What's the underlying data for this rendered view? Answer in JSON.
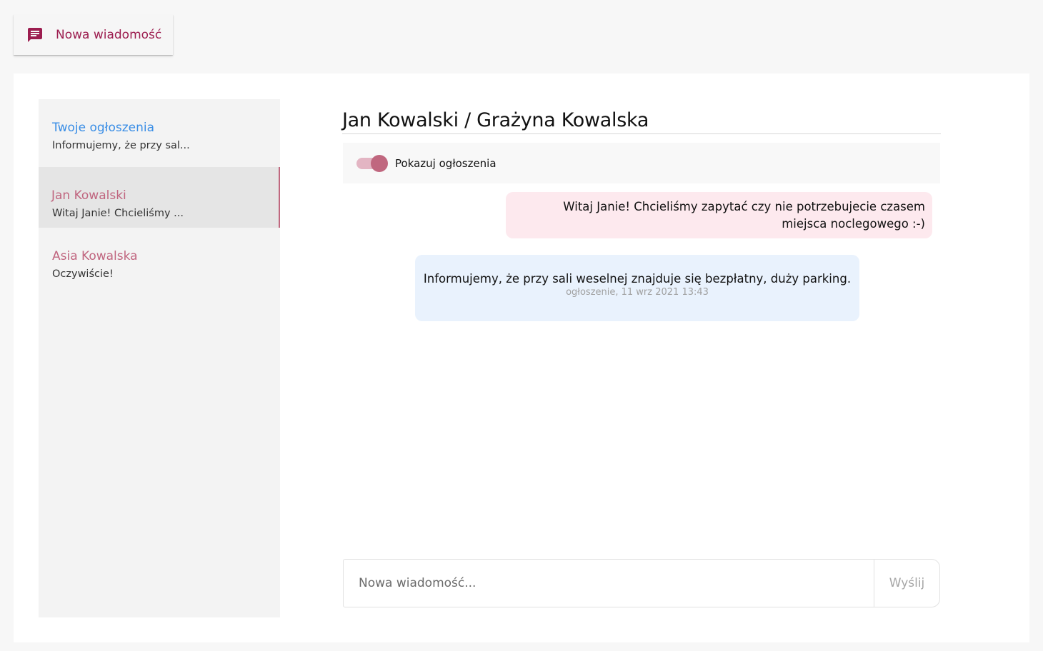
{
  "toolbar": {
    "new_message_label": "Nowa wiadomość",
    "new_message_icon": "chat-message-icon"
  },
  "colors": {
    "accent_pink": "#c0677f",
    "accent_dark_pink": "#9c1d4f",
    "link_blue": "#3a8ee6",
    "outgoing_bubble": "#fde9ee",
    "announcement_bubble": "#e9f2fd"
  },
  "sidebar": {
    "items": [
      {
        "title": "Twoje ogłoszenia",
        "preview": "Informujemy, że przy sal...",
        "active": false
      },
      {
        "title": "Jan Kowalski",
        "preview": "Witaj Janie! Chcieliśmy ...",
        "active": true
      },
      {
        "title": "Asia Kowalska",
        "preview": "Oczywiście!",
        "active": false
      }
    ]
  },
  "chat": {
    "title": "Jan Kowalski / Grażyna Kowalska",
    "toggle": {
      "label": "Pokazuj ogłoszenia",
      "checked": true
    },
    "messages": [
      {
        "type": "outgoing",
        "text": "Witaj Janie! Chcieliśmy zapytać czy nie potrzebujecie czasem miejsca noclegowego :-)"
      },
      {
        "type": "announcement",
        "text": "Informujemy, że przy sali weselnej znajduje się bezpłatny, duży parking.",
        "meta": "ogłoszenie, 11 wrz 2021 13:43"
      }
    ],
    "composer": {
      "placeholder": "Nowa wiadomość...",
      "value": "",
      "send_label": "Wyślij"
    }
  }
}
